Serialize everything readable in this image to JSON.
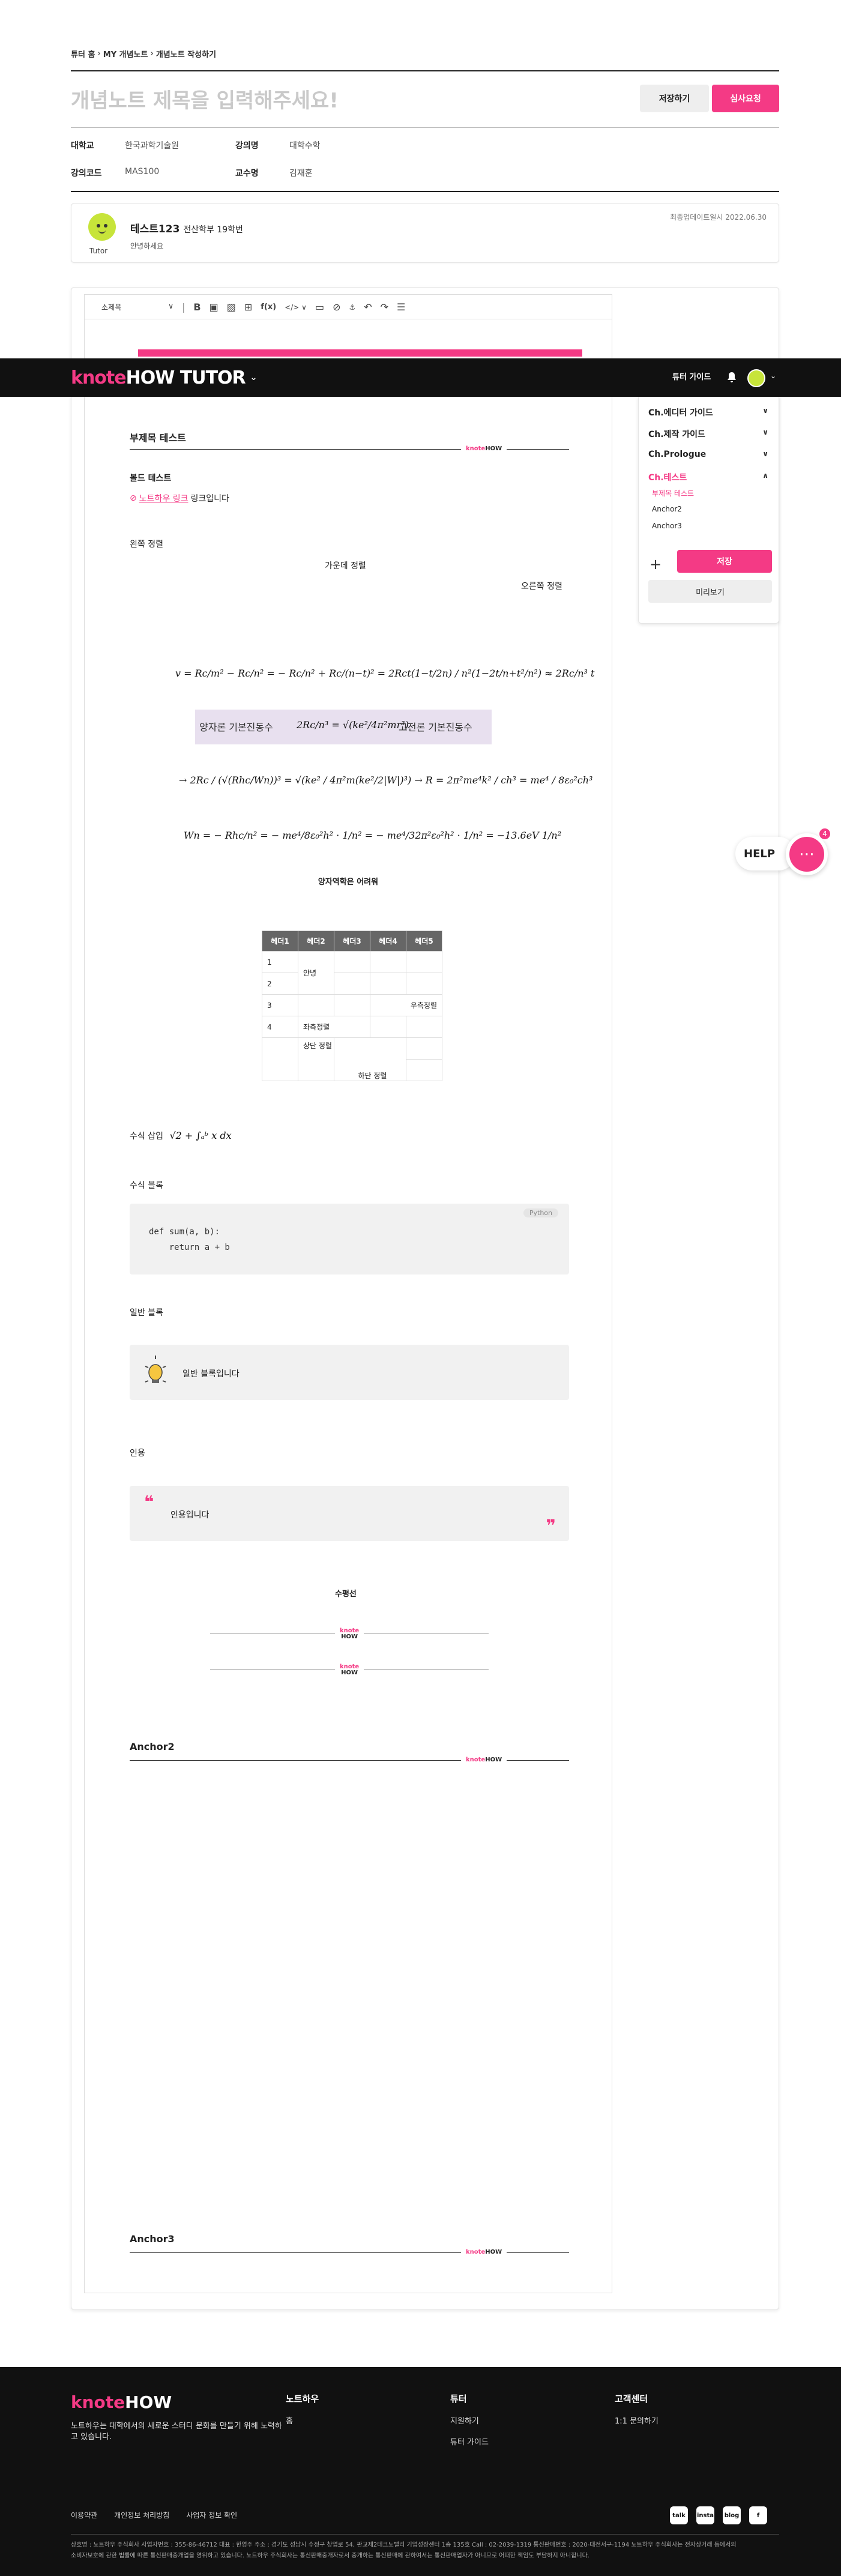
{
  "breadcrumb": [
    "튜터 홈",
    "MY 개념노트",
    "개념노트 작성하기"
  ],
  "title_placeholder": "개념노트 제목을 입력해주세요!",
  "actions": {
    "save": "저장하기",
    "review": "심사요청"
  },
  "meta": {
    "school_k": "대학교",
    "school_v": "한국과학기술원",
    "course_k": "강의명",
    "course_v": "대학수학",
    "code_k": "강의코드",
    "code_v": "MAS100",
    "prof_k": "교수명",
    "prof_v": "김재훈"
  },
  "author": {
    "name": "테스트123",
    "dept": "전산학부 19학번",
    "greeting": "안녕하세요",
    "role": "Tutor",
    "updated": "최종업데이트일시 2022.06.30"
  },
  "toolbar": {
    "style": "소제목"
  },
  "navbar": {
    "logo_a": "knote",
    "logo_b": "HOW TUTOR",
    "guide": "튜터 가이드"
  },
  "side": {
    "chapters": [
      {
        "label": "Ch.에디터 가이드",
        "arrow": "∨"
      },
      {
        "label": "Ch.제작 가이드",
        "arrow": "∨"
      },
      {
        "label": "Ch.Prologue",
        "arrow": "∨"
      },
      {
        "label": "Ch.테스트",
        "arrow": "∧"
      }
    ],
    "subs": [
      "부제목 테스트",
      "Anchor2",
      "Anchor3"
    ],
    "plus": "+",
    "save": "저장",
    "preview": "미리보기"
  },
  "content": {
    "sub_title": "부제목 테스트",
    "bold_test": "볼드 테스트",
    "link_text": "노트하우 링크",
    "link_suffix": "링크입니다",
    "left_align": "왼쪽 정렬",
    "center_align": "가운데 정렬",
    "right_align": "오른쪽 정렬",
    "eq1": "v = Rc/m² − Rc/n² = − Rc/n² + Rc/(n−t)² = 2Rct(1−t/2n) / n²(1−2t/n+t²/n²) ≈ 2Rc/n³ t",
    "eq2_a": "양자론 기본진동수",
    "eq2_b": "2Rc/n³ = √(ke²/4π²mr³)",
    "eq2_c": "고전론 기본진동수",
    "eq3": "→ 2Rc / (√(Rhc/Wn))³ = √(ke² / 4π²m(ke²/2|W|)³)  → R = 2π²me⁴k² / ch³ = me⁴ / 8ε₀²ch³",
    "eq4": "Wn = − Rhc/n² = − me⁴/8ε₀²h² · 1/n² = − me⁴/32π²ε₀²h² · 1/n² = −13.6eV 1/n²",
    "eq_caption": "양자역학은 어려워",
    "table_headers": [
      "헤더1",
      "헤더2",
      "헤더3",
      "헤더4",
      "헤더5"
    ],
    "table_cells": {
      "r1": "1",
      "r2": "2",
      "r3": "3",
      "r4": "4",
      "guide": "안녕",
      "right": "우측정렬",
      "left": "좌측정렬",
      "top": "상단 정렬",
      "bottom": "하단 정렬"
    },
    "formula_insert": "수식 삽입",
    "formula_inline": "√2 + ∫ₐᵇ x dx",
    "formula_block": "수식 블록",
    "code_lang": "Python",
    "code": "def sum(a, b):\n    return a + b",
    "normal_block": "일반 블록",
    "normal_text": "일반 블록입니다",
    "quote_h": "인용",
    "quote_text": "인용입니다",
    "hline_h": "수평선",
    "anchor2": "Anchor2",
    "anchor3": "Anchor3",
    "mini_logo_a": "knote",
    "mini_logo_b": "HOW"
  },
  "help": {
    "label": "HELP",
    "badge": "4"
  },
  "footer": {
    "logo_a": "knote",
    "logo_b": "HOW",
    "desc": "노트하우는 대학에서의 새로운 스터디 문화를 만들기 위해 노력하고 있습니다.",
    "col1_h": "노트하우",
    "col1_i1": "홈",
    "col2_h": "튜터",
    "col2_i1": "지원하기",
    "col2_i2": "튜터 가이드",
    "col3_h": "고객센터",
    "col3_i1": "1:1 문의하기",
    "links": [
      "이용약관",
      "개인정보 처리방침",
      "사업자 정보 확인"
    ],
    "legal1": "상호명 : 노트하우 주식회사 사업자번호 : 355-86-46712 대표 : 한영주 주소 : 경기도 성남시 수정구 창업로 54, 판교제2테크노밸리 기업성장센터 1층 135호 Call : 02-2039-1319 통신판매번호 : 2020-대전서구-1194 노트하우 주식회사는 전자상거래 등에서의",
    "legal2": "소비자보호에 관한 법률에 따른 통신판매중개업을 영위하고 있습니다. 노트하우 주식회사는 통신판매중개자로서 중개하는 통신판매에 관하여서는 통신판매업자가 아니므로 어떠한 책임도 부담하지 아니합니다.",
    "social": [
      "talk",
      "insta",
      "blog",
      "f"
    ]
  }
}
